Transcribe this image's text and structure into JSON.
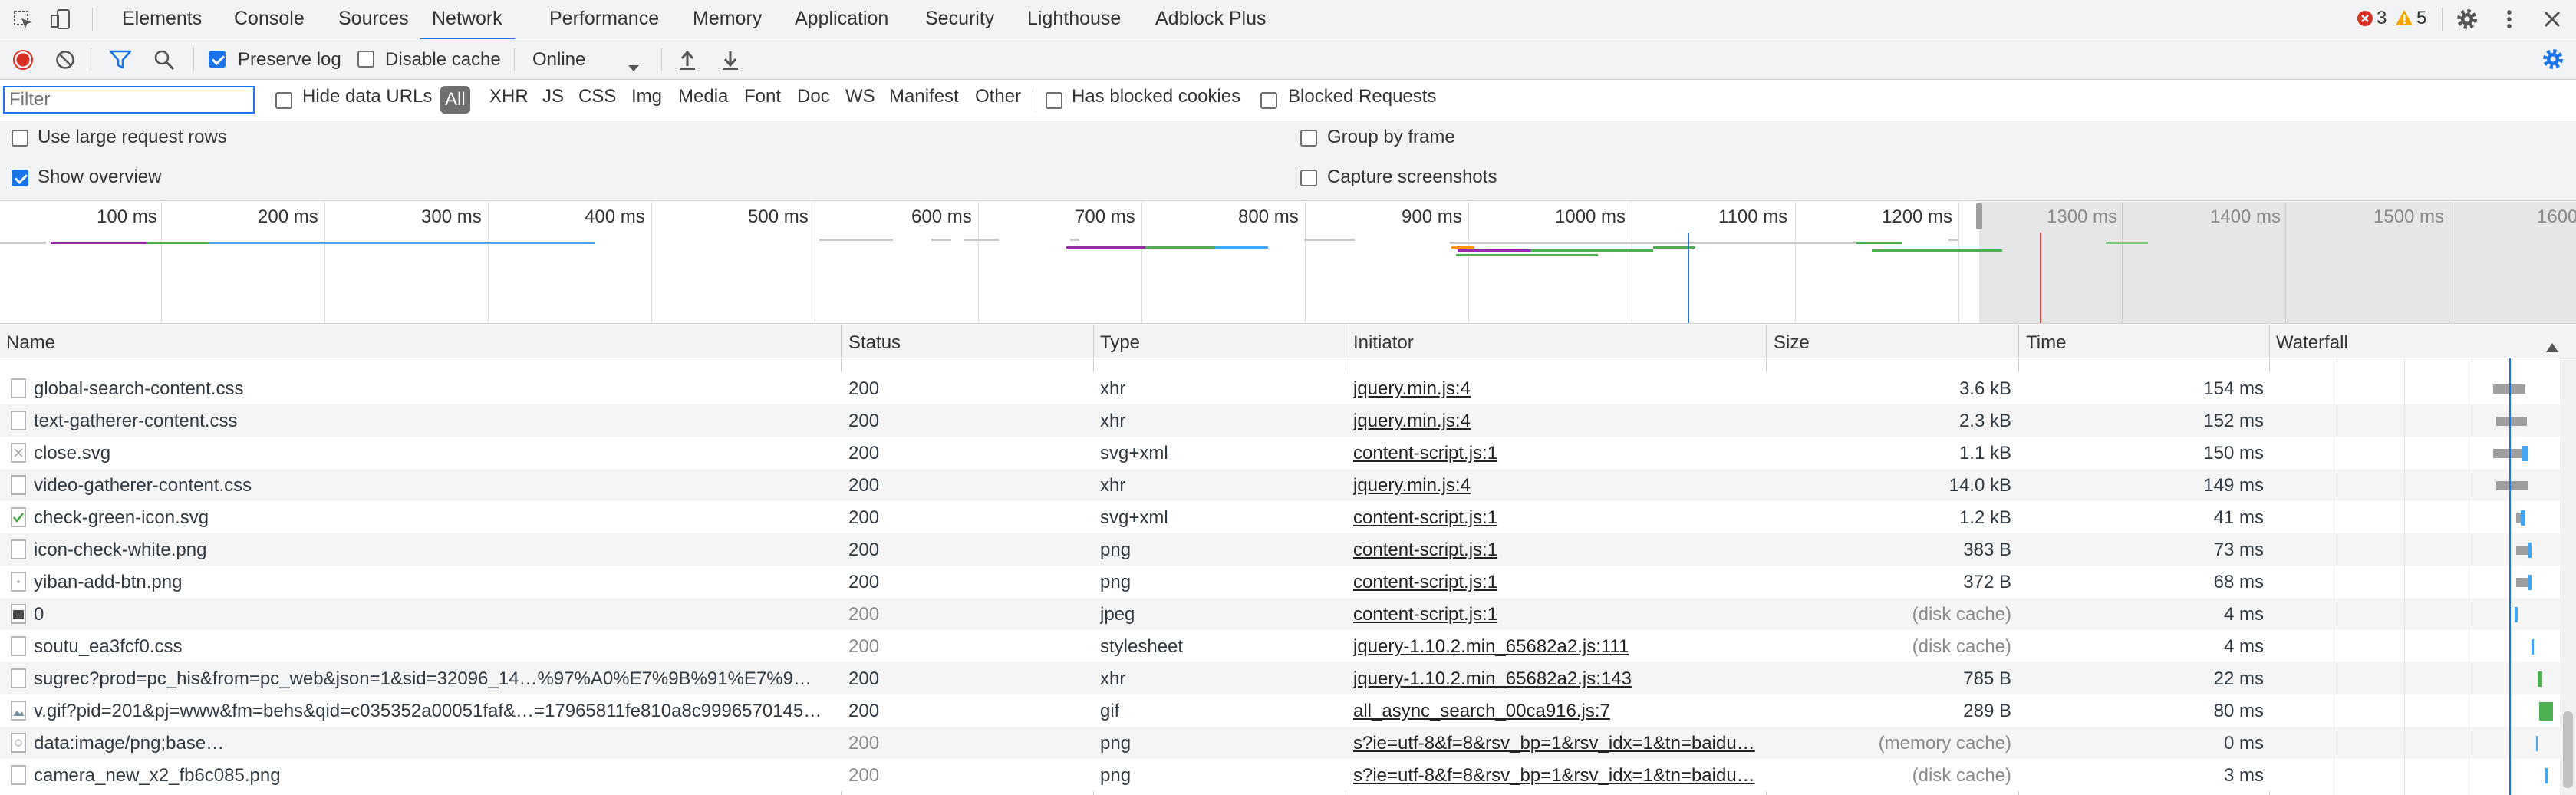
{
  "tabs": [
    "Elements",
    "Console",
    "Sources",
    "Network",
    "Performance",
    "Memory",
    "Application",
    "Security",
    "Lighthouse",
    "Adblock Plus"
  ],
  "active_tab": "Network",
  "counts": {
    "errors": "3",
    "warnings": "5"
  },
  "toolbar": {
    "preserve_log": "Preserve log",
    "disable_cache": "Disable cache",
    "throttling": "Online"
  },
  "filterbar": {
    "placeholder": "Filter",
    "hide_data_urls": "Hide data URLs",
    "types": [
      "All",
      "XHR",
      "JS",
      "CSS",
      "Img",
      "Media",
      "Font",
      "Doc",
      "WS",
      "Manifest",
      "Other"
    ],
    "has_blocked_cookies": "Has blocked cookies",
    "blocked_requests": "Blocked Requests"
  },
  "settings": {
    "large_rows": "Use large request rows",
    "show_overview": "Show overview",
    "group_by_frame": "Group by frame",
    "capture_screenshots": "Capture screenshots"
  },
  "overview_ticks": [
    "100 ms",
    "200 ms",
    "300 ms",
    "400 ms",
    "500 ms",
    "600 ms",
    "700 ms",
    "800 ms",
    "900 ms",
    "1000 ms",
    "1100 ms",
    "1200 ms",
    "1300 ms",
    "1400 ms",
    "1500 ms",
    "1600"
  ],
  "columns": [
    "Name",
    "Status",
    "Type",
    "Initiator",
    "Size",
    "Time",
    "Waterfall"
  ],
  "rows": [
    {
      "name": "global-search-content.css",
      "status": "200",
      "type": "xhr",
      "initiator": "jquery.min.js:4",
      "size": "3.6 kB",
      "time": "154 ms"
    },
    {
      "name": "text-gatherer-content.css",
      "status": "200",
      "type": "xhr",
      "initiator": "jquery.min.js:4",
      "size": "2.3 kB",
      "time": "152 ms"
    },
    {
      "name": "close.svg",
      "status": "200",
      "type": "svg+xml",
      "initiator": "content-script.js:1",
      "size": "1.1 kB",
      "time": "150 ms"
    },
    {
      "name": "video-gatherer-content.css",
      "status": "200",
      "type": "xhr",
      "initiator": "jquery.min.js:4",
      "size": "14.0 kB",
      "time": "149 ms"
    },
    {
      "name": "check-green-icon.svg",
      "status": "200",
      "type": "svg+xml",
      "initiator": "content-script.js:1",
      "size": "1.2 kB",
      "time": "41 ms"
    },
    {
      "name": "icon-check-white.png",
      "status": "200",
      "type": "png",
      "initiator": "content-script.js:1",
      "size": "383 B",
      "time": "73 ms"
    },
    {
      "name": "yiban-add-btn.png",
      "status": "200",
      "type": "png",
      "initiator": "content-script.js:1",
      "size": "372 B",
      "time": "68 ms"
    },
    {
      "name": "0",
      "status": "200",
      "type": "jpeg",
      "initiator": "content-script.js:1",
      "size": "(disk cache)",
      "time": "4 ms"
    },
    {
      "name": "soutu_ea3fcf0.css",
      "status": "200",
      "type": "stylesheet",
      "initiator": "jquery-1.10.2.min_65682a2.js:111",
      "size": "(disk cache)",
      "time": "4 ms"
    },
    {
      "name": "sugrec?prod=pc_his&from=pc_web&json=1&sid=32096_14…%97%A0%E7%9B%91%E7%9…",
      "status": "200",
      "type": "xhr",
      "initiator": "jquery-1.10.2.min_65682a2.js:143",
      "size": "785 B",
      "time": "22 ms"
    },
    {
      "name": "v.gif?pid=201&pj=www&fm=behs&qid=c035352a00051faf&…=17965811fe810a8c9996570145…",
      "status": "200",
      "type": "gif",
      "initiator": "all_async_search_00ca916.js:7",
      "size": "289 B",
      "time": "80 ms"
    },
    {
      "name": "data:image/png;base…",
      "status": "200",
      "type": "png",
      "initiator": "s?ie=utf-8&f=8&rsv_bp=1&rsv_idx=1&tn=baidu…",
      "size": "(memory cache)",
      "time": "0 ms"
    },
    {
      "name": "camera_new_x2_fb6c085.png",
      "status": "200",
      "type": "png",
      "initiator": "s?ie=utf-8&f=8&rsv_bp=1&rsv_idx=1&tn=baidu…",
      "size": "(disk cache)",
      "time": "3 ms"
    }
  ]
}
